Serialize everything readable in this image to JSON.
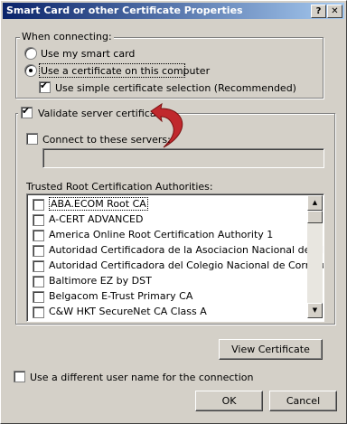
{
  "window": {
    "title": "Smart Card or other Certificate Properties",
    "help_label": "?",
    "close_label": "✕"
  },
  "connecting": {
    "group_label": "When connecting:",
    "smart_card": "Use my smart card",
    "certificate": "Use a certificate on this computer",
    "simple_selection": "Use simple certificate selection (Recommended)"
  },
  "validate_label": "Validate server certificate",
  "connect_servers_label": "Connect to these servers:",
  "servers_value": "",
  "trusted_label": "Trusted Root Certification Authorities:",
  "authorities": [
    "ABA.ECOM Root CA",
    "A-CERT ADVANCED",
    "America Online Root Certification Authority 1",
    "Autoridad Certificadora de la Asociacion Nacional del Notariado",
    "Autoridad Certificadora del Colegio Nacional de Correduria Pu",
    "Baltimore EZ by DST",
    "Belgacom E-Trust Primary CA",
    "C&W HKT SecureNet CA Class A"
  ],
  "view_certificate_label": "View Certificate",
  "different_user_label": "Use a different user name for the connection",
  "ok_label": "OK",
  "cancel_label": "Cancel",
  "colors": {
    "title_start": "#0a246a",
    "title_end": "#a6caf0",
    "arrow": "#c0282d",
    "face": "#d4d0c8"
  }
}
